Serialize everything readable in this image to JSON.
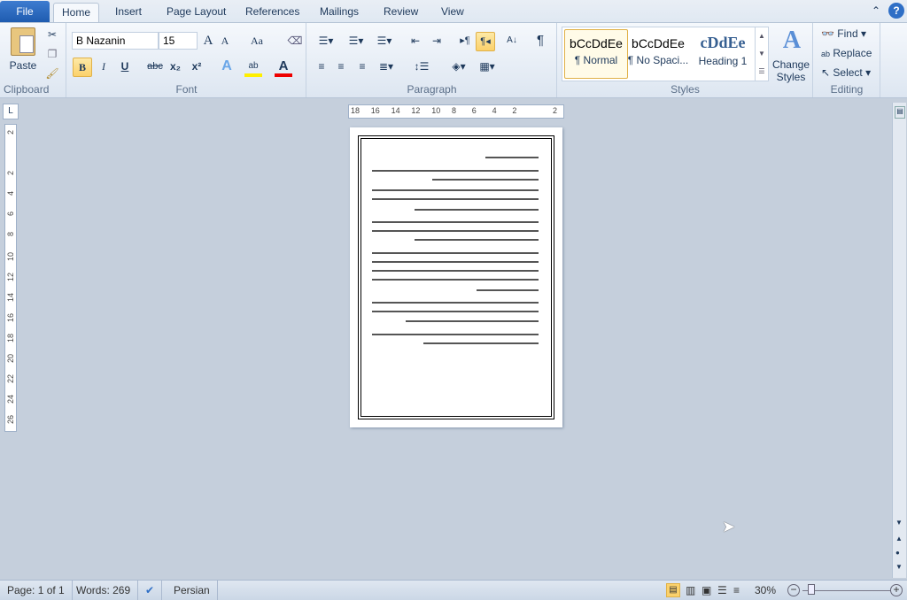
{
  "tabs": {
    "file": "File",
    "items": [
      "Home",
      "Insert",
      "Page Layout",
      "References",
      "Mailings",
      "Review",
      "View"
    ],
    "active": "Home"
  },
  "clipboard": {
    "paste": "Paste",
    "label": "Clipboard"
  },
  "font": {
    "name": "B Nazanin",
    "size": "15",
    "label": "Font",
    "bold": "B",
    "italic": "I",
    "underline": "U",
    "strike": "abc",
    "sub": "x₂",
    "sup": "x²",
    "grow": "A",
    "shrink": "A",
    "case": "Aa"
  },
  "paragraph": {
    "label": "Paragraph",
    "show_marks": "¶"
  },
  "styles": {
    "label": "Styles",
    "items": [
      {
        "preview": "bCcDdEe",
        "name": "¶ Normal"
      },
      {
        "preview": "bCcDdEe",
        "name": "¶ No Spaci..."
      },
      {
        "preview": "cDdEe",
        "name": "Heading 1"
      }
    ],
    "change": "Change Styles"
  },
  "editing": {
    "label": "Editing",
    "find": "Find",
    "replace": "Replace",
    "select": "Select"
  },
  "ruler": {
    "h_ticks": [
      "18",
      "16",
      "14",
      "12",
      "10",
      "8",
      "6",
      "4",
      "2",
      "",
      "2"
    ],
    "v_ticks": [
      "2",
      "",
      "2",
      "4",
      "6",
      "8",
      "10",
      "12",
      "14",
      "16",
      "18",
      "20",
      "22",
      "24",
      "26"
    ]
  },
  "status": {
    "page": "Page: 1 of 1",
    "words": "Words: 269",
    "language": "Persian",
    "zoom": "30%",
    "zoom_level_percent": 30
  },
  "colors": {
    "accent": "#2b579a",
    "file_tab": "#2a64b8",
    "highlight": "#fbd16b",
    "page_bg": "#c5cfdc"
  }
}
